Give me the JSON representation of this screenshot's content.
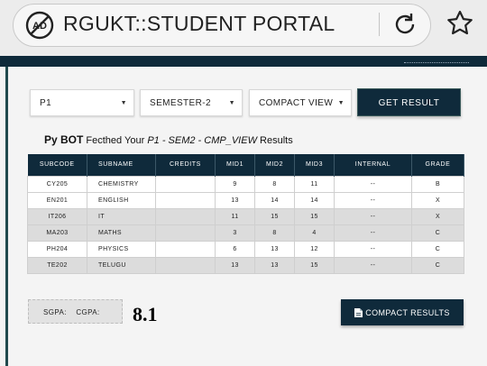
{
  "browser": {
    "url": "RGUKT::STUDENT PORTAL",
    "left_icon": "adblock-icon",
    "right_icons": [
      "reload-icon",
      "star-icon"
    ]
  },
  "controls": {
    "year": "P1",
    "semester": "SEMESTER-2",
    "view": "COMPACT VIEW",
    "get_result": "GET RESULT"
  },
  "fetched": {
    "bot": "Py BOT",
    "text1": "Fecthed Your",
    "query": "P1 - SEM2 - CMP_VIEW",
    "text2": "Results"
  },
  "table": {
    "headers": [
      "SUBCODE",
      "SUBNAME",
      "CREDITS",
      "MID1",
      "MID2",
      "MID3",
      "INTERNAL",
      "GRADE"
    ],
    "rows": [
      [
        "CY205",
        "CHEMISTRY",
        "",
        "9",
        "8",
        "11",
        "--",
        "B"
      ],
      [
        "EN201",
        "ENGLISH",
        "",
        "13",
        "14",
        "14",
        "--",
        "X"
      ],
      [
        "IT206",
        "IT",
        "",
        "11",
        "15",
        "15",
        "--",
        "X"
      ],
      [
        "MA203",
        "MATHS",
        "",
        "3",
        "8",
        "4",
        "--",
        "C"
      ],
      [
        "PH204",
        "PHYSICS",
        "",
        "6",
        "13",
        "12",
        "--",
        "C"
      ],
      [
        "TE202",
        "TELUGU",
        "",
        "13",
        "13",
        "15",
        "--",
        "C"
      ]
    ]
  },
  "footer": {
    "gpa_label": "SGPA:    CGPA:",
    "gpa_value": "8.1",
    "compact_results": "COMPACT RESULTS",
    "compact_icon": "document-icon"
  },
  "colors": {
    "header_bg": "#0f2a3b",
    "row_alt": "#dcdcdc"
  }
}
